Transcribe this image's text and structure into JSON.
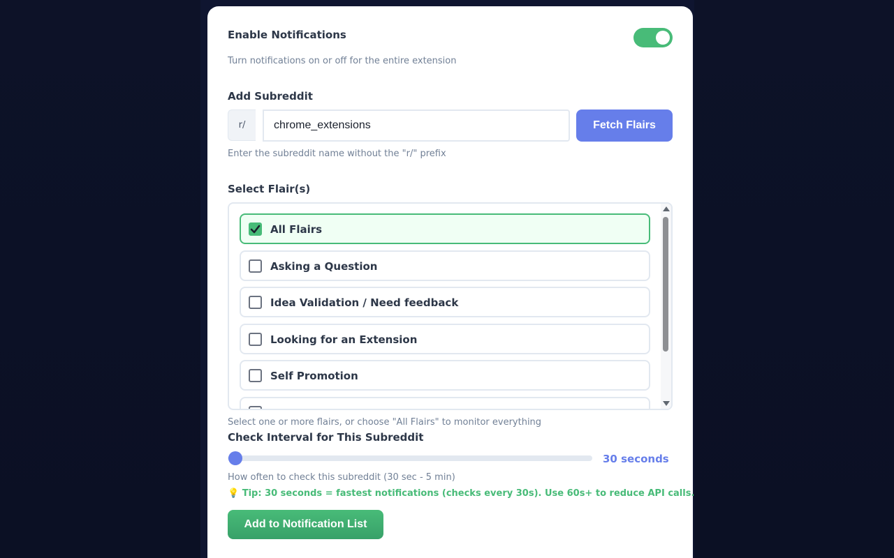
{
  "notifications": {
    "label": "Enable Notifications",
    "help": "Turn notifications on or off for the entire extension",
    "enabled": true,
    "toggle_color": "#48bb78"
  },
  "subreddit": {
    "label": "Add Subreddit",
    "prefix": "r/",
    "value": "chrome_extensions",
    "fetch_label": "Fetch Flairs",
    "help": "Enter the subreddit name without the \"r/\" prefix"
  },
  "flairs": {
    "label": "Select Flair(s)",
    "items": [
      {
        "label": "All Flairs",
        "checked": true
      },
      {
        "label": "Asking a Question",
        "checked": false
      },
      {
        "label": "Idea Validation / Need feedback",
        "checked": false
      },
      {
        "label": "Looking for an Extension",
        "checked": false
      },
      {
        "label": "Self Promotion",
        "checked": false
      }
    ],
    "help": "Select one or more flairs, or choose \"All Flairs\" to monitor everything"
  },
  "interval": {
    "label": "Check Interval for This Subreddit",
    "value_text": "30 seconds",
    "value_seconds": 30,
    "min_seconds": 30,
    "max_seconds": 300,
    "help": "How often to check this subreddit (30 sec - 5 min)",
    "tip": "💡 Tip: 30 seconds = fastest notifications (checks every 30s). Use 60s+ to reduce API calls."
  },
  "add_button": {
    "label": "Add to Notification List"
  },
  "colors": {
    "primary": "#667eea",
    "success": "#48bb78",
    "background": "#0d1226"
  }
}
